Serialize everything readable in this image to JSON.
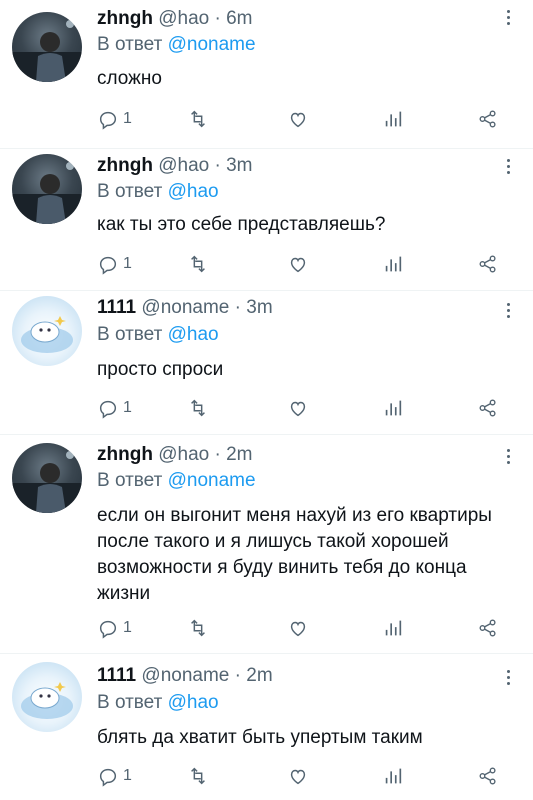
{
  "tweets": [
    {
      "avatar": "dark-photo-avatar",
      "name": "zhngh",
      "handle": "@hao",
      "time": "6m",
      "reply_prefix": "В ответ",
      "reply_to": "@noname",
      "text": "сложно",
      "reply_count": "1"
    },
    {
      "avatar": "dark-photo-avatar",
      "name": "zhngh",
      "handle": "@hao",
      "time": "3m",
      "reply_prefix": "В ответ",
      "reply_to": "@hao",
      "text": "как ты это себе представляешь?",
      "reply_count": "1"
    },
    {
      "avatar": "light-cartoon-avatar",
      "name": "1111",
      "handle": "@noname",
      "time": "3m",
      "reply_prefix": "В ответ",
      "reply_to": "@hao",
      "text": "просто спроси",
      "reply_count": "1"
    },
    {
      "avatar": "dark-photo-avatar",
      "name": "zhngh",
      "handle": "@hao",
      "time": "2m",
      "reply_prefix": "В ответ",
      "reply_to": "@noname",
      "text": "если он выгонит меня нахуй из его квартиры после такого и я лишусь такой хорошей возможности я буду винить тебя до конца жизни",
      "reply_count": "1"
    },
    {
      "avatar": "light-cartoon-avatar",
      "name": "1111",
      "handle": "@noname",
      "time": "2m",
      "reply_prefix": "В ответ",
      "reply_to": "@hao",
      "text": "блять да хватит быть упертым таким",
      "reply_count": "1"
    }
  ],
  "separator": "·",
  "colors": {
    "link": "#1d9bf0",
    "muted": "#536471",
    "text": "#0f1419"
  },
  "icons": [
    "reply-icon",
    "retweet-icon",
    "like-icon",
    "views-icon",
    "share-icon",
    "more-icon"
  ]
}
